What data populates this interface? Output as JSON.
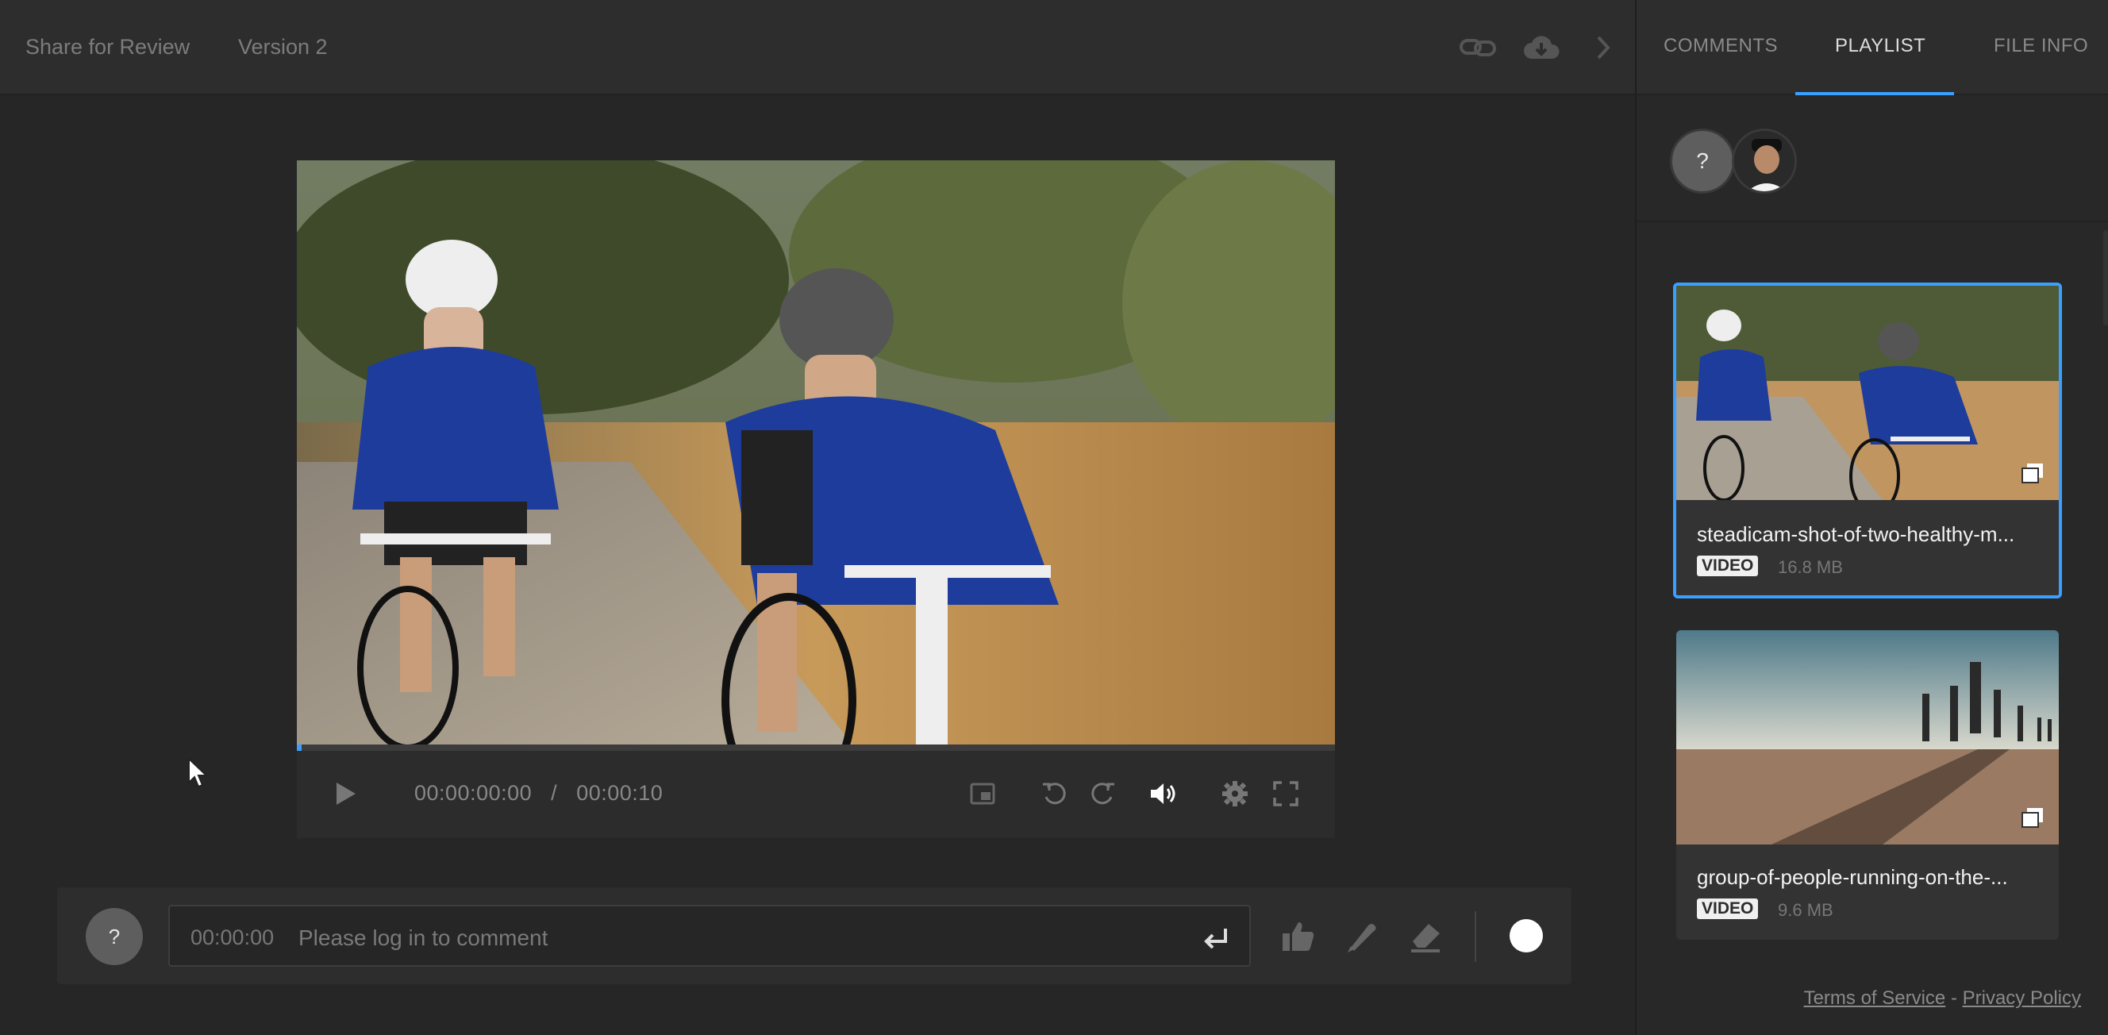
{
  "header": {
    "title": "Share for Review",
    "version": "Version 2"
  },
  "player": {
    "current_time": "00:00:00:00",
    "separator": "/",
    "duration": "00:00:10",
    "progress": 0
  },
  "comment": {
    "timestamp": "00:00:00",
    "placeholder": "Please log in to comment",
    "avatar_initial": "?"
  },
  "sidebar": {
    "tabs": [
      {
        "label": "COMMENTS"
      },
      {
        "label": "PLAYLIST"
      },
      {
        "label": "FILE INFO"
      }
    ],
    "active_tab": "PLAYLIST",
    "member_initial": "?",
    "playlist": [
      {
        "name": "steadicam-shot-of-two-healthy-m...",
        "type": "VIDEO",
        "size": "16.8 MB",
        "selected": true
      },
      {
        "name": "group-of-people-running-on-the-...",
        "type": "VIDEO",
        "size": "9.6 MB",
        "selected": false
      }
    ]
  },
  "footer": {
    "terms": "Terms of Service",
    "separator": "-",
    "privacy": "Privacy Policy"
  },
  "colors": {
    "accent": "#3aa0ff",
    "background": "#262626"
  },
  "icons": [
    "link-icon",
    "cloud-download-icon",
    "chevron-right-icon",
    "play-icon",
    "picture-in-picture-icon",
    "rewind-icon",
    "forward-icon",
    "volume-icon",
    "gear-icon",
    "fullscreen-icon",
    "enter-icon",
    "thumbs-up-icon",
    "pen-icon",
    "eraser-icon",
    "stack-icon"
  ]
}
